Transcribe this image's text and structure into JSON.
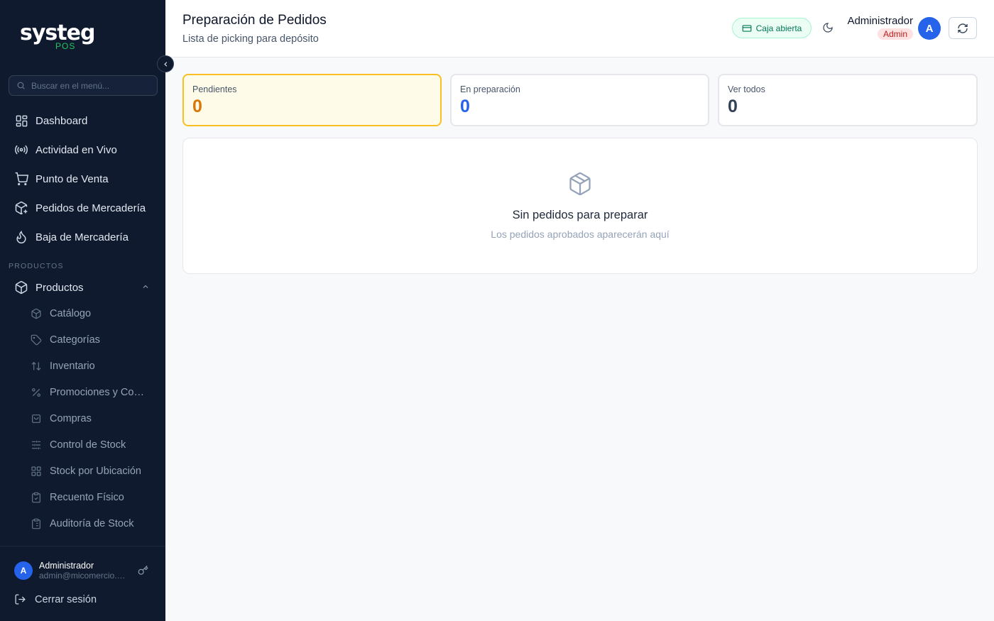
{
  "brand": {
    "name": "systeg",
    "sub": "POS"
  },
  "sidebar": {
    "search_placeholder": "Buscar en el menú...",
    "items": [
      {
        "label": "Dashboard",
        "icon": "dashboard-icon"
      },
      {
        "label": "Actividad en Vivo",
        "icon": "broadcast-icon"
      },
      {
        "label": "Punto de Venta",
        "icon": "cart-icon"
      },
      {
        "label": "Pedidos de Mercadería",
        "icon": "package-plus-icon"
      },
      {
        "label": "Baja de Mercadería",
        "icon": "flame-icon"
      }
    ],
    "section_label": "PRODUCTOS",
    "group": {
      "label": "Productos",
      "icon": "box-icon",
      "expanded": true
    },
    "subitems": [
      {
        "label": "Catálogo",
        "icon": "box-icon"
      },
      {
        "label": "Categorías",
        "icon": "tag-icon"
      },
      {
        "label": "Inventario",
        "icon": "sort-arrows-icon"
      },
      {
        "label": "Promociones y Combos",
        "icon": "percent-icon"
      },
      {
        "label": "Compras",
        "icon": "shopping-bag-icon"
      },
      {
        "label": "Control de Stock",
        "icon": "sliders-icon"
      },
      {
        "label": "Stock por Ubicación",
        "icon": "grid-icon"
      },
      {
        "label": "Recuento Físico",
        "icon": "clipboard-check-icon"
      },
      {
        "label": "Auditoría de Stock",
        "icon": "clipboard-list-icon"
      }
    ],
    "user": {
      "initial": "A",
      "name": "Administrador",
      "email": "admin@micomercio.com"
    },
    "logout_label": "Cerrar sesión"
  },
  "header": {
    "title": "Preparación de Pedidos",
    "subtitle": "Lista de picking para depósito",
    "caja_status": "Caja abierta",
    "user_name": "Administrador",
    "user_role": "Admin",
    "avatar_initial": "A"
  },
  "stats": [
    {
      "label": "Pendientes",
      "value": "0",
      "color": "#d97706",
      "active": true
    },
    {
      "label": "En preparación",
      "value": "0",
      "color": "#2563eb",
      "active": false
    },
    {
      "label": "Ver todos",
      "value": "0",
      "color": "#334155",
      "active": false
    }
  ],
  "empty_state": {
    "icon": "box-icon",
    "title": "Sin pedidos para preparar",
    "description": "Los pedidos aprobados aparecerán aquí"
  },
  "colors": {
    "sidebar_bg": "#0f1a2e",
    "accent": "#2563eb",
    "success": "#22c55e",
    "warning": "#fbbf24"
  }
}
